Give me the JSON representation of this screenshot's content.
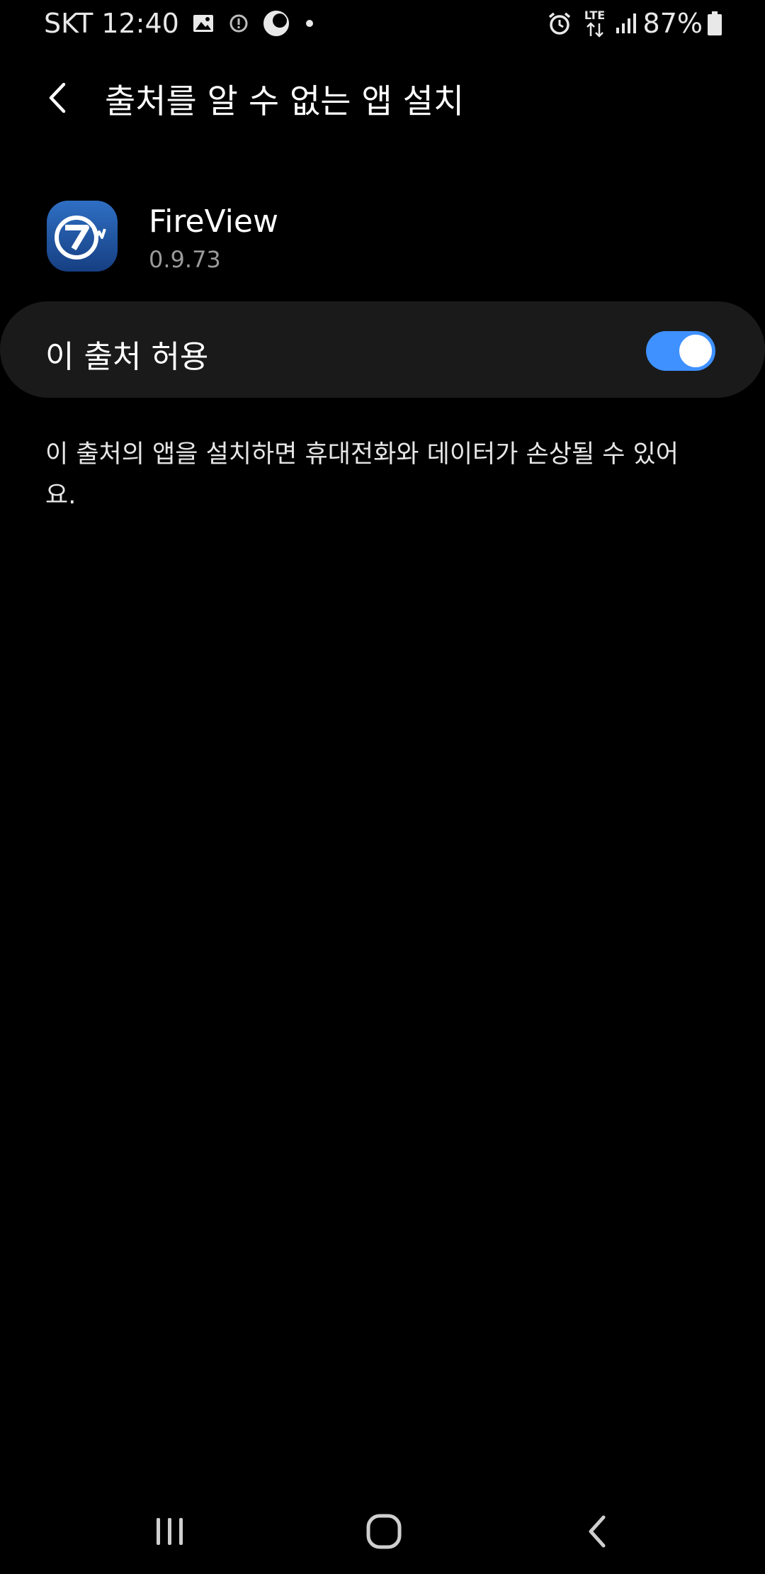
{
  "status_bar": {
    "carrier": "SKT",
    "time": "12:40",
    "battery_percent": "87%",
    "network_type": "LTE",
    "icons": [
      "gallery-icon",
      "alert-circle-icon",
      "moon-icon",
      "dot-icon",
      "alarm-icon",
      "lte-data-icon",
      "signal-icon",
      "battery-icon"
    ]
  },
  "app_bar": {
    "title": "출처를 알 수 없는 앱 설치",
    "back_icon": "back-chevron-icon"
  },
  "app_info": {
    "name": "FireView",
    "version": "0.9.73",
    "icon_color": "#1f5aa8"
  },
  "allow_setting": {
    "label": "이 출처 허용",
    "enabled": true,
    "toggle_color": "#3e91ff"
  },
  "warning": {
    "text": "이 출처의 앱을 설치하면 휴대전화와 데이터가 손상될 수 있어요."
  },
  "nav_bar": {
    "icons": [
      "recent-apps-icon",
      "home-icon",
      "back-icon"
    ]
  }
}
